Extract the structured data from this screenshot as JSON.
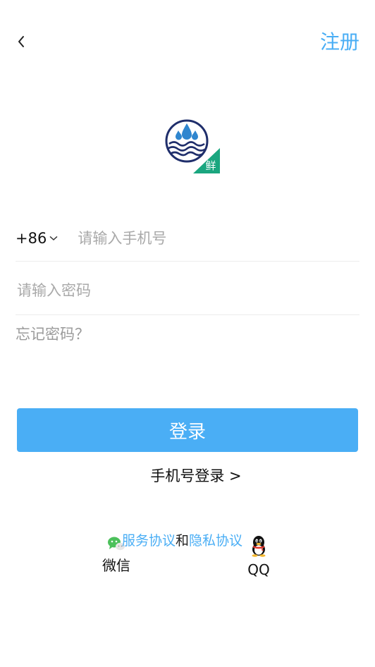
{
  "header": {
    "back_icon": "chevron-left-icon",
    "register_label": "注册"
  },
  "logo": {
    "badge_text": "鲜",
    "colors": {
      "navy": "#1f2e6b",
      "blue": "#2f86cf",
      "green": "#1aa67f"
    }
  },
  "form": {
    "country_code": "+86",
    "phone_placeholder": "请输入手机号",
    "password_placeholder": "请输入密码",
    "forgot_label": "忘记密码？"
  },
  "actions": {
    "login_label": "登录",
    "phone_login_label": "手机号登录 >"
  },
  "agreement": {
    "service_label": "服务协议",
    "connector": "和",
    "privacy_label": "隐私协议"
  },
  "social": {
    "wechat_label": "微信",
    "wechat_icon": "wechat-icon",
    "qq_label": "QQ",
    "qq_icon": "qq-penguin-icon"
  },
  "colors": {
    "accent": "#4aaef5",
    "placeholder": "#a9a9a9",
    "divider": "#ececec"
  }
}
